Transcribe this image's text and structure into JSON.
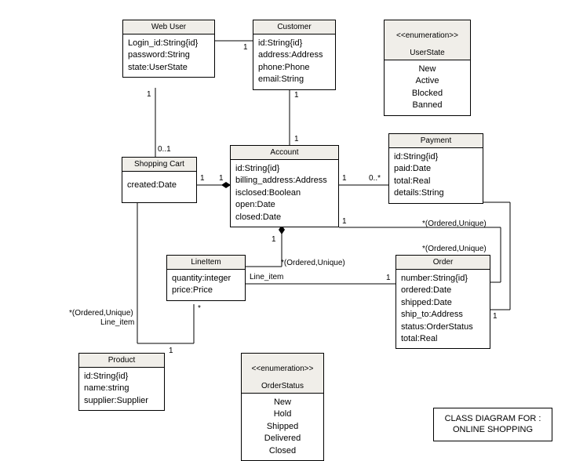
{
  "classes": {
    "webUser": {
      "name": "Web User",
      "attrs": [
        "Login_id:String{id}",
        "password:String",
        "state:UserState"
      ]
    },
    "customer": {
      "name": "Customer",
      "attrs": [
        "id:String{id}",
        "address:Address",
        "phone:Phone",
        "email:String"
      ]
    },
    "userState": {
      "stereotype": "<<enumeration>>",
      "name": "UserState",
      "values": [
        "New",
        "Active",
        "Blocked",
        "Banned"
      ]
    },
    "shoppingCart": {
      "name": "Shopping Cart",
      "attrs": [
        "created:Date"
      ]
    },
    "account": {
      "name": "Account",
      "attrs": [
        "id:String{id}",
        "billing_address:Address",
        "isclosed:Boolean",
        "open:Date",
        "closed:Date"
      ]
    },
    "payment": {
      "name": "Payment",
      "attrs": [
        "id:String{id}",
        "paid:Date",
        "total:Real",
        "details:String"
      ]
    },
    "lineItem": {
      "name": "LineItem",
      "attrs": [
        "quantity:integer",
        "price:Price"
      ]
    },
    "order": {
      "name": "Order",
      "attrs": [
        "number:String{id}",
        "ordered:Date",
        "shipped:Date",
        "ship_to:Address",
        "status:OrderStatus",
        "total:Real"
      ]
    },
    "product": {
      "name": "Product",
      "attrs": [
        "id:String{id}",
        "name:string",
        "supplier:Supplier"
      ]
    },
    "orderStatus": {
      "stereotype": "<<enumeration>>",
      "name": "OrderStatus",
      "values": [
        "New",
        "Hold",
        "Shipped",
        "Delivered",
        "Closed"
      ]
    }
  },
  "title": {
    "line1": "CLASS DIAGRAM FOR :",
    "line2": "ONLINE SHOPPING"
  },
  "labels": {
    "m1": "1",
    "m01": "0..1",
    "m0star": "0..*",
    "mstar": "*",
    "orderedUnique": "*(Ordered,Unique)",
    "lineItemRole": "Line_item"
  }
}
